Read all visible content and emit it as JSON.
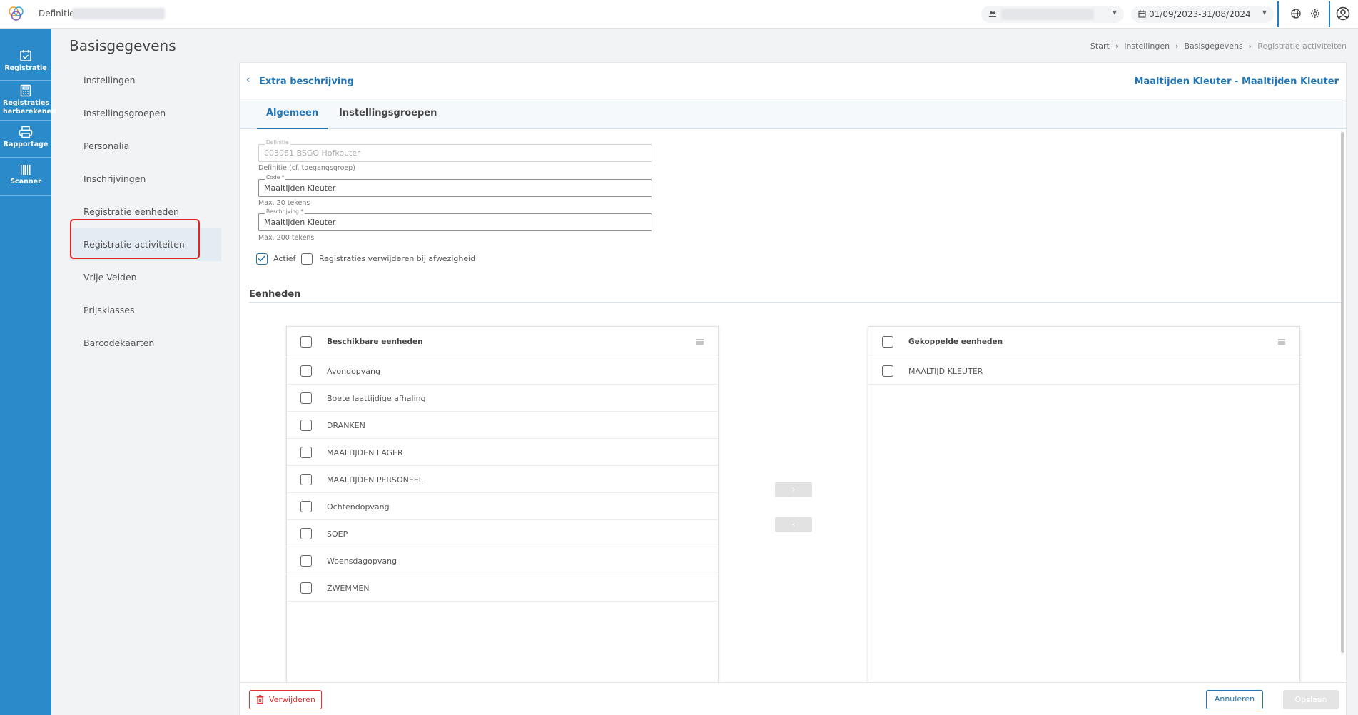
{
  "topbar": {
    "definition_label": "Definitie:",
    "date_range": "01/09/2023-31/08/2024",
    "icons": [
      "app-logo",
      "users-icon",
      "calendar-icon",
      "globe-icon",
      "gear-icon",
      "user-circle-icon"
    ]
  },
  "rail": {
    "items": [
      {
        "label": "Registratie",
        "icon": "calendar-check-icon"
      },
      {
        "label": "Registraties herberekenen",
        "icon": "calculator-icon"
      },
      {
        "label": "Rapportage",
        "icon": "printer-icon"
      },
      {
        "label": "Scanner",
        "icon": "barcode-icon"
      }
    ]
  },
  "page": {
    "title": "Basisgegevens",
    "breadcrumb": [
      "Start",
      "Instellingen",
      "Basisgegevens",
      "Registratie activiteiten"
    ]
  },
  "settings_nav": {
    "items": [
      {
        "label": "Instellingen"
      },
      {
        "label": "Instellingsgroepen"
      },
      {
        "label": "Personalia"
      },
      {
        "label": "Inschrijvingen"
      },
      {
        "label": "Registratie eenheden"
      },
      {
        "label": "Registratie activiteiten",
        "active": true
      },
      {
        "label": "Vrije Velden"
      },
      {
        "label": "Prijsklasses"
      },
      {
        "label": "Barcodekaarten"
      }
    ]
  },
  "card": {
    "back_label": "Extra beschrijving",
    "right_title": "Maaltijden Kleuter - Maaltijden Kleuter",
    "tabs": [
      {
        "label": "Algemeen",
        "active": true
      },
      {
        "label": "Instellingsgroepen"
      }
    ],
    "form": {
      "definitie": {
        "label": "Definitie",
        "value": "003061 BSGO Hofkouter",
        "hint": "Definitie (cf. toegangsgroep)"
      },
      "code": {
        "label": "Code *",
        "value": "Maaltijden Kleuter",
        "hint": "Max. 20 tekens"
      },
      "beschrijving": {
        "label": "Beschrijving *",
        "value": "Maaltijden Kleuter",
        "hint": "Max. 200 tekens"
      },
      "actief": {
        "label": "Actief",
        "checked": true
      },
      "verwijderen": {
        "label": "Registraties verwijderen bij afwezigheid",
        "checked": false
      }
    },
    "eenheden": {
      "title": "Eenheden",
      "available": {
        "header": "Beschikbare eenheden",
        "items": [
          "Avondopvang",
          "Boete laattijdige afhaling",
          "DRANKEN",
          "MAALTIJDEN LAGER",
          "MAALTIJDEN PERSONEEL",
          "Ochtendopvang",
          "SOEP",
          "Woensdagopvang",
          "ZWEMMEN"
        ]
      },
      "linked": {
        "header": "Gekoppelde eenheden",
        "items": [
          "MAALTIJD KLEUTER"
        ]
      },
      "move_right": "›",
      "move_left": "‹"
    },
    "footer": {
      "delete_label": "Verwijderen",
      "cancel_label": "Annuleren",
      "save_label": "Opslaan"
    }
  },
  "colors": {
    "rail": "#2b8ac9",
    "accent": "#2275b4",
    "danger": "#d33333",
    "highlight": "#e02424"
  }
}
